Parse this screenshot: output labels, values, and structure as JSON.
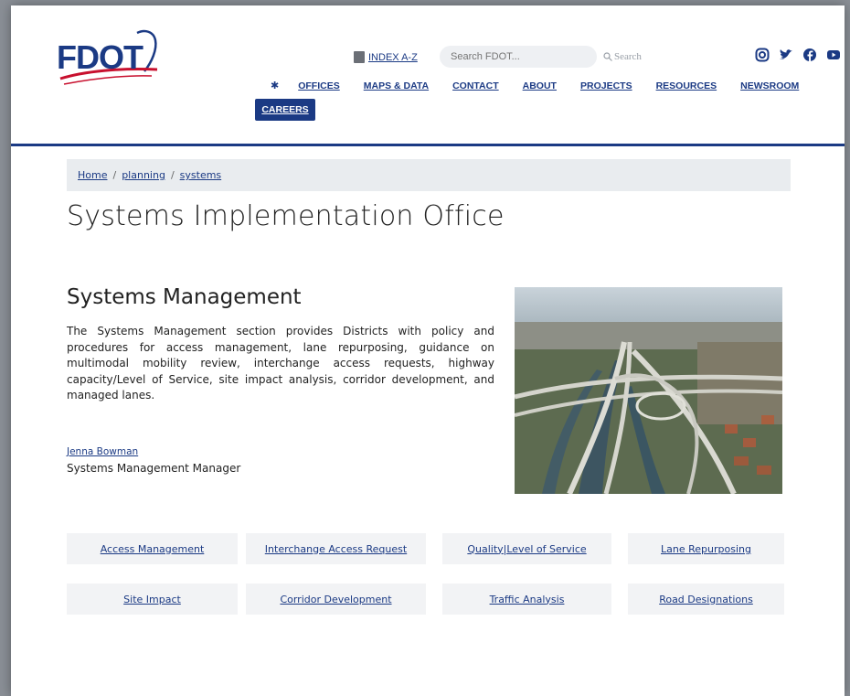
{
  "brand": {
    "logo_text": "FDOT",
    "primary_color": "#1b3a84",
    "accent_red": "#c8102e"
  },
  "utility": {
    "index_label": "INDEX A-Z",
    "search_placeholder": "Search FDOT...",
    "search_button": "Search",
    "social_icons": [
      "instagram-icon",
      "twitter-icon",
      "facebook-icon",
      "youtube-icon"
    ]
  },
  "nav": {
    "home_icon": "home-icon",
    "items": [
      "OFFICES",
      "MAPS & DATA",
      "CONTACT",
      "ABOUT",
      "PROJECTS",
      "RESOURCES",
      "NEWSROOM"
    ],
    "careers": "CAREERS"
  },
  "breadcrumb": [
    "Home",
    "planning",
    "systems"
  ],
  "page_title": "Systems Implementation Office",
  "section": {
    "title": "Systems Management",
    "body": "The Systems Management section provides Districts with policy and procedures for access management, lane repurposing, guidance on multimodal mobility review, interchange access requests, highway capacity/Level of Service, site impact analysis, corridor development, and managed lanes.",
    "contact_name": "Jenna Bowman",
    "contact_role": "Systems Management Manager"
  },
  "links": [
    "Access Management",
    "Interchange Access Request",
    "Quality|Level of Service",
    "Lane Repurposing",
    "Site Impact",
    "Corridor Development",
    "Traffic Analysis",
    "Road Designations"
  ]
}
